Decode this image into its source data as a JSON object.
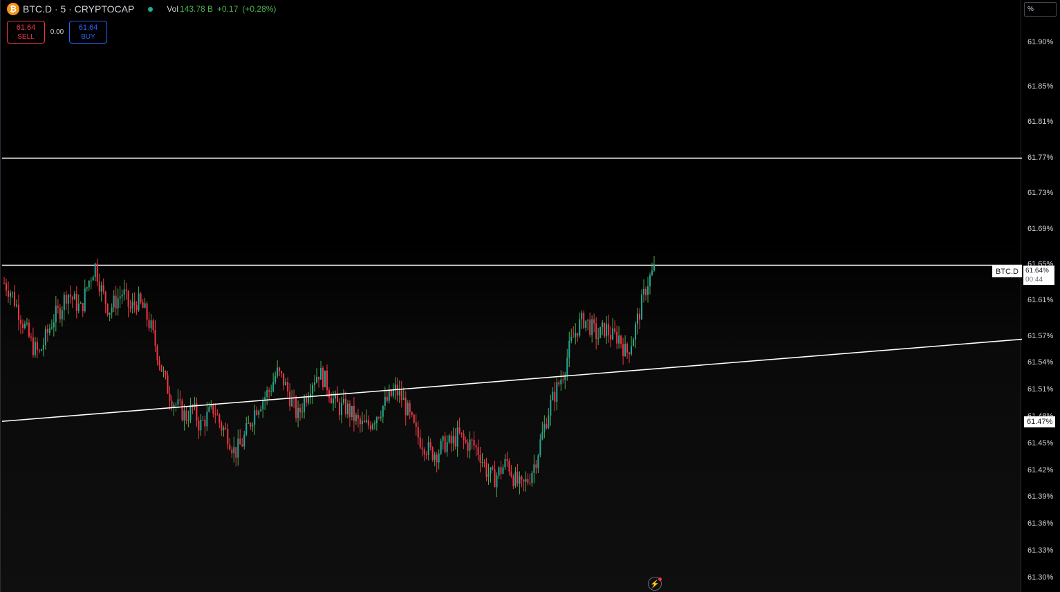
{
  "legend": {
    "symbol": "BTC.D · 5 · CRYPTOCAP",
    "vol_label": "Vol",
    "vol_value": "143.78 B",
    "change": "+0.17",
    "change_pct": "(+0.28%)"
  },
  "trade": {
    "sell_price": "61.64",
    "sell_label": "SELL",
    "spread": "0.00",
    "buy_price": "61.64",
    "buy_label": "BUY"
  },
  "axis": {
    "unit": "%",
    "ticks": [
      "61.90%",
      "61.85%",
      "61.81%",
      "61.77%",
      "61.73%",
      "61.69%",
      "61.65%",
      "61.61%",
      "61.57%",
      "61.54%",
      "61.51%",
      "61.48%",
      "61.45%",
      "61.42%",
      "61.39%",
      "61.36%",
      "61.33%",
      "61.30%"
    ]
  },
  "price_tag": {
    "symbol": "BTC.D",
    "price": "61.64%",
    "countdown": "00:44"
  },
  "line_label": "61.47%",
  "colors": {
    "up": "#26a69a",
    "up_wick": "#4caf50",
    "down": "#f23645",
    "line": "#ffffff",
    "background": "#000000"
  },
  "icons": {
    "coin": "bitcoin-icon",
    "bolt": "lightning-icon"
  },
  "chart_data": {
    "type": "candlestick",
    "interval": "5",
    "ylim": [
      61.3,
      61.92
    ],
    "horizontal_lines": [
      61.77,
      61.65
    ],
    "trend_line": {
      "start": 61.475,
      "end": 61.567
    },
    "close_path": [
      61.63,
      61.62,
      61.6,
      61.58,
      61.56,
      61.55,
      61.57,
      61.59,
      61.6,
      61.62,
      61.61,
      61.6,
      61.63,
      61.65,
      61.62,
      61.6,
      61.61,
      61.62,
      61.6,
      61.61,
      61.6,
      61.58,
      61.55,
      61.52,
      61.5,
      61.49,
      61.48,
      61.49,
      61.47,
      61.48,
      61.49,
      61.47,
      61.46,
      61.44,
      61.45,
      61.47,
      61.49,
      61.5,
      61.51,
      61.53,
      61.52,
      61.5,
      61.48,
      61.5,
      61.52,
      61.53,
      61.52,
      61.5,
      61.49,
      61.49,
      61.48,
      61.47,
      61.47,
      61.48,
      61.49,
      61.5,
      61.51,
      61.5,
      61.48,
      61.46,
      61.45,
      61.44,
      61.44,
      61.45,
      61.45,
      61.46,
      61.45,
      61.45,
      61.44,
      61.42,
      61.41,
      61.42,
      61.43,
      61.41,
      61.4,
      61.41,
      61.43,
      61.46,
      61.49,
      61.51,
      61.53,
      61.56,
      61.58,
      61.59,
      61.58,
      61.57,
      61.58,
      61.57,
      61.57,
      61.55,
      61.57,
      61.6,
      61.63,
      61.645
    ]
  }
}
